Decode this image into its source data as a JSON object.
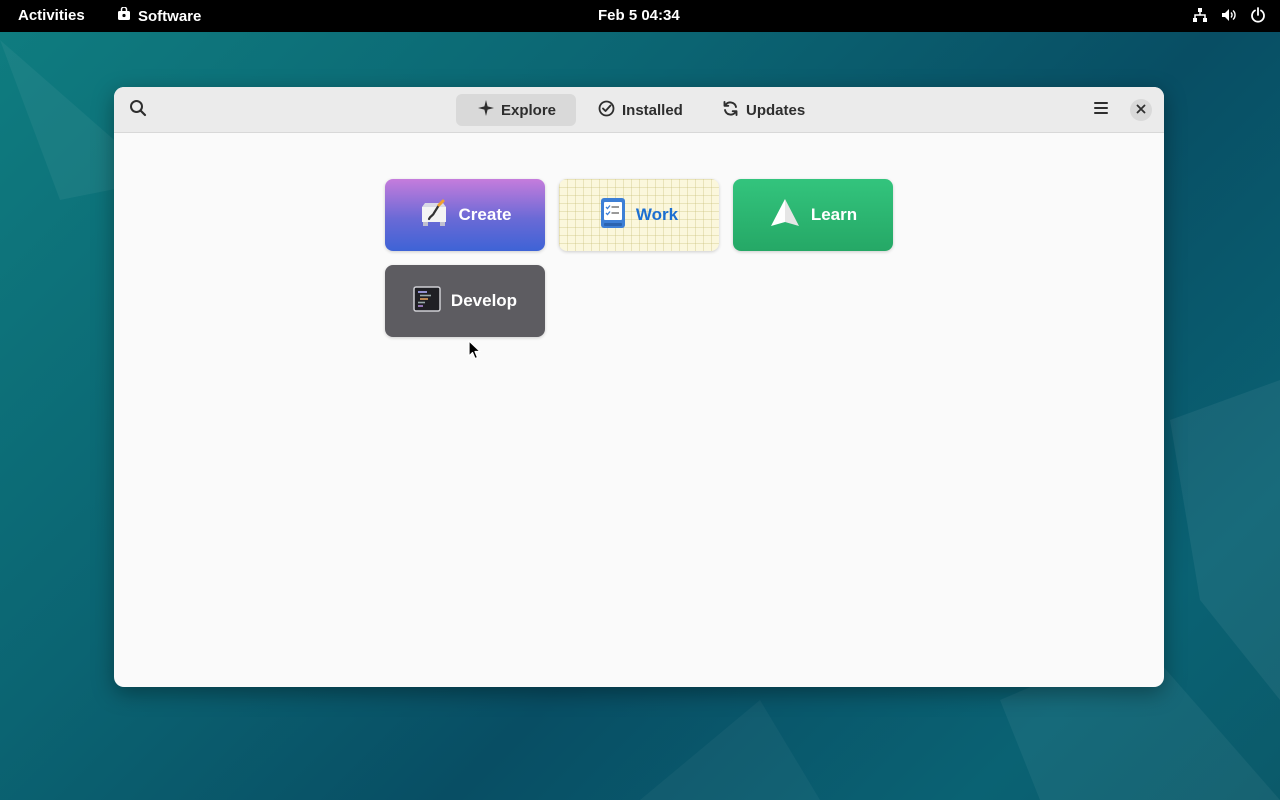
{
  "topbar": {
    "activities": "Activities",
    "app_name": "Software",
    "clock": "Feb 5  04:34",
    "tray_icons": [
      "network-icon",
      "volume-icon",
      "power-icon"
    ]
  },
  "window": {
    "tabs": [
      {
        "label": "Explore",
        "icon": "explore-icon",
        "active": true
      },
      {
        "label": "Installed",
        "icon": "check-circle-icon",
        "active": false
      },
      {
        "label": "Updates",
        "icon": "refresh-icon",
        "active": false
      }
    ],
    "categories": [
      {
        "label": "Create",
        "icon": "create-icon",
        "color": "#5a66d8"
      },
      {
        "label": "Work",
        "icon": "work-icon",
        "color": "#1c6fd1"
      },
      {
        "label": "Learn",
        "icon": "learn-icon",
        "color": "#2db673"
      },
      {
        "label": "Develop",
        "icon": "terminal-icon",
        "color": "#5d5c61"
      }
    ]
  },
  "colors": {
    "accent": "#1c6fd1",
    "desktop": "#0b6472"
  }
}
